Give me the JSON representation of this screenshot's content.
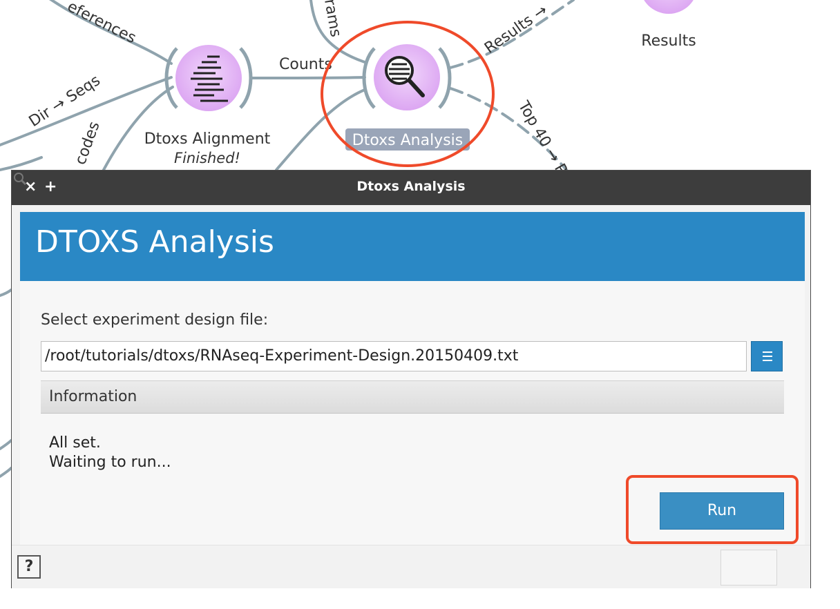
{
  "canvas": {
    "edges": {
      "references": "eferences",
      "dir_seqs": "Dir → Seqs",
      "codes": "codes",
      "grams": "rams",
      "counts": "Counts",
      "results": "Results →",
      "top40": "Top 40 → P"
    },
    "nodes": {
      "alignment": {
        "label": "Dtoxs Alignment",
        "status": "Finished!"
      },
      "analysis": {
        "label": "Dtoxs Analysis"
      },
      "results": {
        "label": "Results"
      }
    }
  },
  "dialog": {
    "window_title": "Dtoxs Analysis",
    "header_title": "DTOXS Analysis",
    "file_label": "Select experiment design file:",
    "file_path": "/root/tutorials/dtoxs/RNAseq-Experiment-Design.20150409.txt",
    "info_title": "Information",
    "info_lines": [
      "All set.",
      "Waiting to run..."
    ],
    "run_label": "Run",
    "help_label": "?",
    "close_glyph": "×",
    "add_glyph": "+"
  },
  "colors": {
    "accent_blue": "#2a88c5",
    "node_fill": "#e4b6f5",
    "annotation_red": "#ef4a2a",
    "edge_gray": "#8fa3ad"
  },
  "icons": {
    "alignment_node": "alignment-lines-icon",
    "analysis_node": "magnifier-icon",
    "browse": "menu-lines-icon",
    "help": "question-icon"
  }
}
